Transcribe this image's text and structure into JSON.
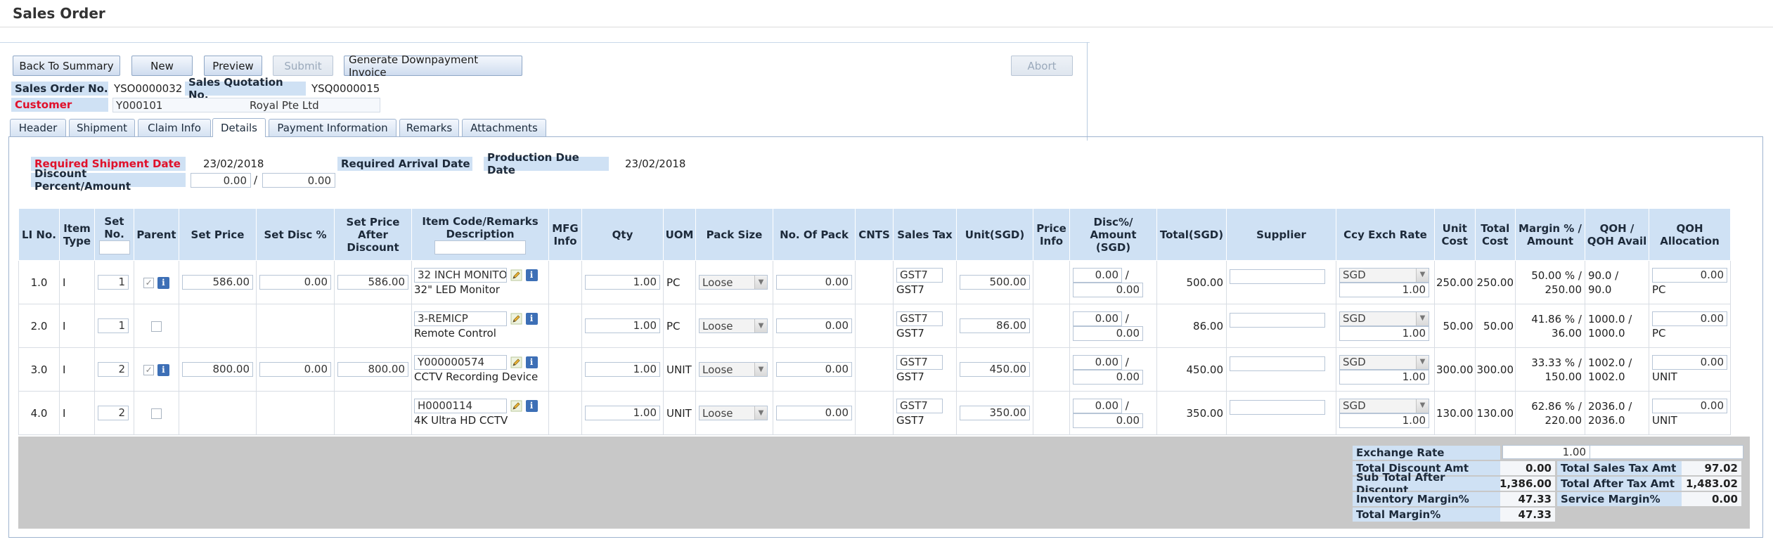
{
  "page": {
    "title": "Sales Order"
  },
  "toolbar": {
    "back_label": "Back To Summary",
    "new_label": "New",
    "preview_label": "Preview",
    "submit_label": "Submit",
    "gen_label": "Generate Downpayment Invoice",
    "abort_label": "Abort"
  },
  "order": {
    "so_label": "Sales Order No.",
    "so_value": "YSO0000032",
    "sq_label": "Sales Quotation No.",
    "sq_value": "YSQ0000015",
    "customer_label": "Customer",
    "customer_code": "Y000101",
    "customer_name": "Royal Pte Ltd"
  },
  "tabs": [
    "Header",
    "Shipment",
    "Claim Info",
    "Details",
    "Payment Information",
    "Remarks",
    "Attachments"
  ],
  "dates": {
    "req_ship_label": "Required Shipment Date",
    "req_ship_value": "23/02/2018",
    "req_arr_label": "Required Arrival Date",
    "prod_due_label": "Production Due Date",
    "prod_due_value": "23/02/2018",
    "disc_label": "Discount Percent/Amount",
    "disc_pct": "0.00",
    "disc_sep": "/",
    "disc_amt": "0.00"
  },
  "grid": {
    "headers": {
      "li": "LI No.",
      "type": "Item Type",
      "setno": "Set No.",
      "parent": "Parent",
      "setprice": "Set Price",
      "setdisc": "Set Disc %",
      "setafter": "Set Price After Discount",
      "itemcode": "Item Code/Remarks Description",
      "mfg": "MFG Info",
      "qty": "Qty",
      "uom": "UOM",
      "pack": "Pack Size",
      "nopack": "No. Of Pack",
      "cnts": "CNTS",
      "tax": "Sales Tax",
      "unit": "Unit(SGD)",
      "priceinfo": "Price Info",
      "disc": "Disc%/ Amount (SGD)",
      "total": "Total(SGD)",
      "supplier": "Supplier",
      "ccy": "Ccy Exch Rate",
      "unitcost": "Unit Cost",
      "totalcost": "Total Cost",
      "margin": "Margin % / Amount",
      "qoh": "QOH / QOH Avail",
      "alloc": "QOH Allocation"
    },
    "rows": [
      {
        "li": "1.0",
        "type": "I",
        "setno": "1",
        "parent": "checked",
        "setprice": "586.00",
        "setdisc": "0.00",
        "setafter": "586.00",
        "code": "32 INCH MONITO",
        "desc": "32\" LED Monitor",
        "qty": "1.00",
        "uom": "PC",
        "pack": "Loose",
        "nopack": "0.00",
        "tax": "GST7",
        "taxname": "GST7",
        "unit": "500.00",
        "discp": "0.00",
        "disca": "0.00",
        "total": "500.00",
        "ccy": "SGD",
        "rate": "1.00",
        "unitcost": "250.00",
        "totalcost": "250.00",
        "marginp": "50.00 % /",
        "margina": "250.00",
        "qoh": "90.0 /",
        "qoha": "90.0",
        "alloc": "0.00",
        "allocuom": "PC"
      },
      {
        "li": "2.0",
        "type": "I",
        "setno": "1",
        "parent": "unchecked",
        "setprice": "",
        "setdisc": "",
        "setafter": "",
        "code": "3-REMICP",
        "desc": "Remote Control",
        "qty": "1.00",
        "uom": "PC",
        "pack": "Loose",
        "nopack": "0.00",
        "tax": "GST7",
        "taxname": "GST7",
        "unit": "86.00",
        "discp": "0.00",
        "disca": "0.00",
        "total": "86.00",
        "ccy": "SGD",
        "rate": "1.00",
        "unitcost": "50.00",
        "totalcost": "50.00",
        "marginp": "41.86 % /",
        "margina": "36.00",
        "qoh": "1000.0 /",
        "qoha": "1000.0",
        "alloc": "0.00",
        "allocuom": "PC"
      },
      {
        "li": "3.0",
        "type": "I",
        "setno": "2",
        "parent": "checked",
        "setprice": "800.00",
        "setdisc": "0.00",
        "setafter": "800.00",
        "code": "Y000000574",
        "desc": "CCTV Recording Device",
        "qty": "1.00",
        "uom": "UNIT",
        "pack": "Loose",
        "nopack": "0.00",
        "tax": "GST7",
        "taxname": "GST7",
        "unit": "450.00",
        "discp": "0.00",
        "disca": "0.00",
        "total": "450.00",
        "ccy": "SGD",
        "rate": "1.00",
        "unitcost": "300.00",
        "totalcost": "300.00",
        "marginp": "33.33 % /",
        "margina": "150.00",
        "qoh": "1002.0 /",
        "qoha": "1002.0",
        "alloc": "0.00",
        "allocuom": "UNIT"
      },
      {
        "li": "4.0",
        "type": "I",
        "setno": "2",
        "parent": "unchecked",
        "setprice": "",
        "setdisc": "",
        "setafter": "",
        "code": "H0000114",
        "desc": "4K Ultra HD CCTV",
        "qty": "1.00",
        "uom": "UNIT",
        "pack": "Loose",
        "nopack": "0.00",
        "tax": "GST7",
        "taxname": "GST7",
        "unit": "350.00",
        "discp": "0.00",
        "disca": "0.00",
        "total": "350.00",
        "ccy": "SGD",
        "rate": "1.00",
        "unitcost": "130.00",
        "totalcost": "130.00",
        "marginp": "62.86 % /",
        "margina": "220.00",
        "qoh": "2036.0 /",
        "qoha": "2036.0",
        "alloc": "0.00",
        "allocuom": "UNIT"
      }
    ]
  },
  "summary": {
    "exch_label": "Exchange Rate",
    "exch_value": "1.00",
    "tda_label": "Total Discount Amt",
    "tda_value": "0.00",
    "tsta_label": "Total Sales Tax Amt",
    "tsta_value": "97.02",
    "stad_label": "Sub Total After Discount",
    "stad_value": "1,386.00",
    "tata_label": "Total After Tax Amt",
    "tata_value": "1,483.02",
    "im_label": "Inventory Margin%",
    "im_value": "47.33",
    "sm_label": "Service Margin%",
    "sm_value": "0.00",
    "tm_label": "Total Margin%",
    "tm_value": "47.33"
  },
  "colors": {
    "label_bg": "#cfe1f4",
    "required_red": "#e0102a",
    "summary_bg": "#c8c8c8"
  }
}
